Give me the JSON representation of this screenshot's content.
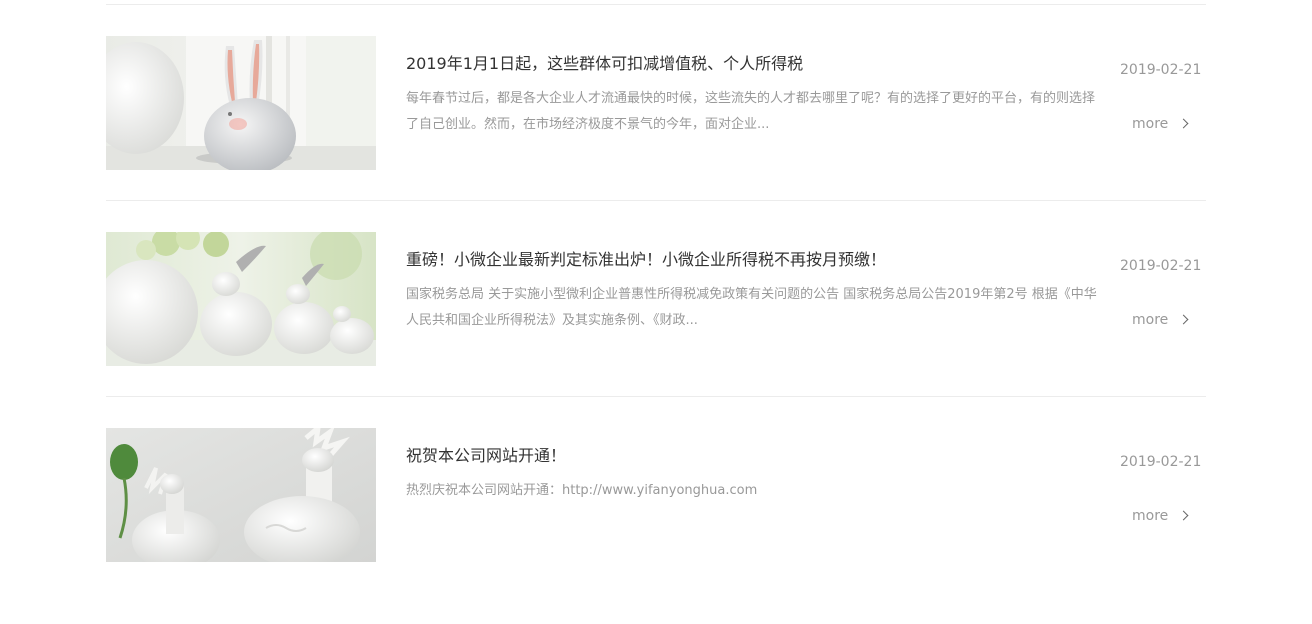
{
  "news": [
    {
      "title": "2019年1月1日起，这些群体可扣减增值税、个人所得税",
      "summary": "每年春节过后，都是各大企业人才流通最快的时候，这些流失的人才都去哪里了呢？有的选择了更好的平台，有的则选择了自己创业。然而，在市场经济极度不景气的今年，面对企业...",
      "date": "2019-02-21",
      "more_label": "more",
      "image_icon": "ceramic-rabbit-image"
    },
    {
      "title": "重磅！小微企业最新判定标准出炉！小微企业所得税不再按月预缴！",
      "summary": "国家税务总局 关于实施小型微利企业普惠性所得税减免政策有关问题的公告 国家税务总局公告2019年第2号 根据《中华人民共和国企业所得税法》及其实施条例、《财政...",
      "date": "2019-02-21",
      "more_label": "more",
      "image_icon": "ceramic-rabbits-flowers-image"
    },
    {
      "title": "祝贺本公司网站开通！",
      "summary": "热烈庆祝本公司网站开通：http://www.yifanyonghua.com",
      "date": "2019-02-21",
      "more_label": "more",
      "image_icon": "ceramic-deer-image"
    }
  ]
}
